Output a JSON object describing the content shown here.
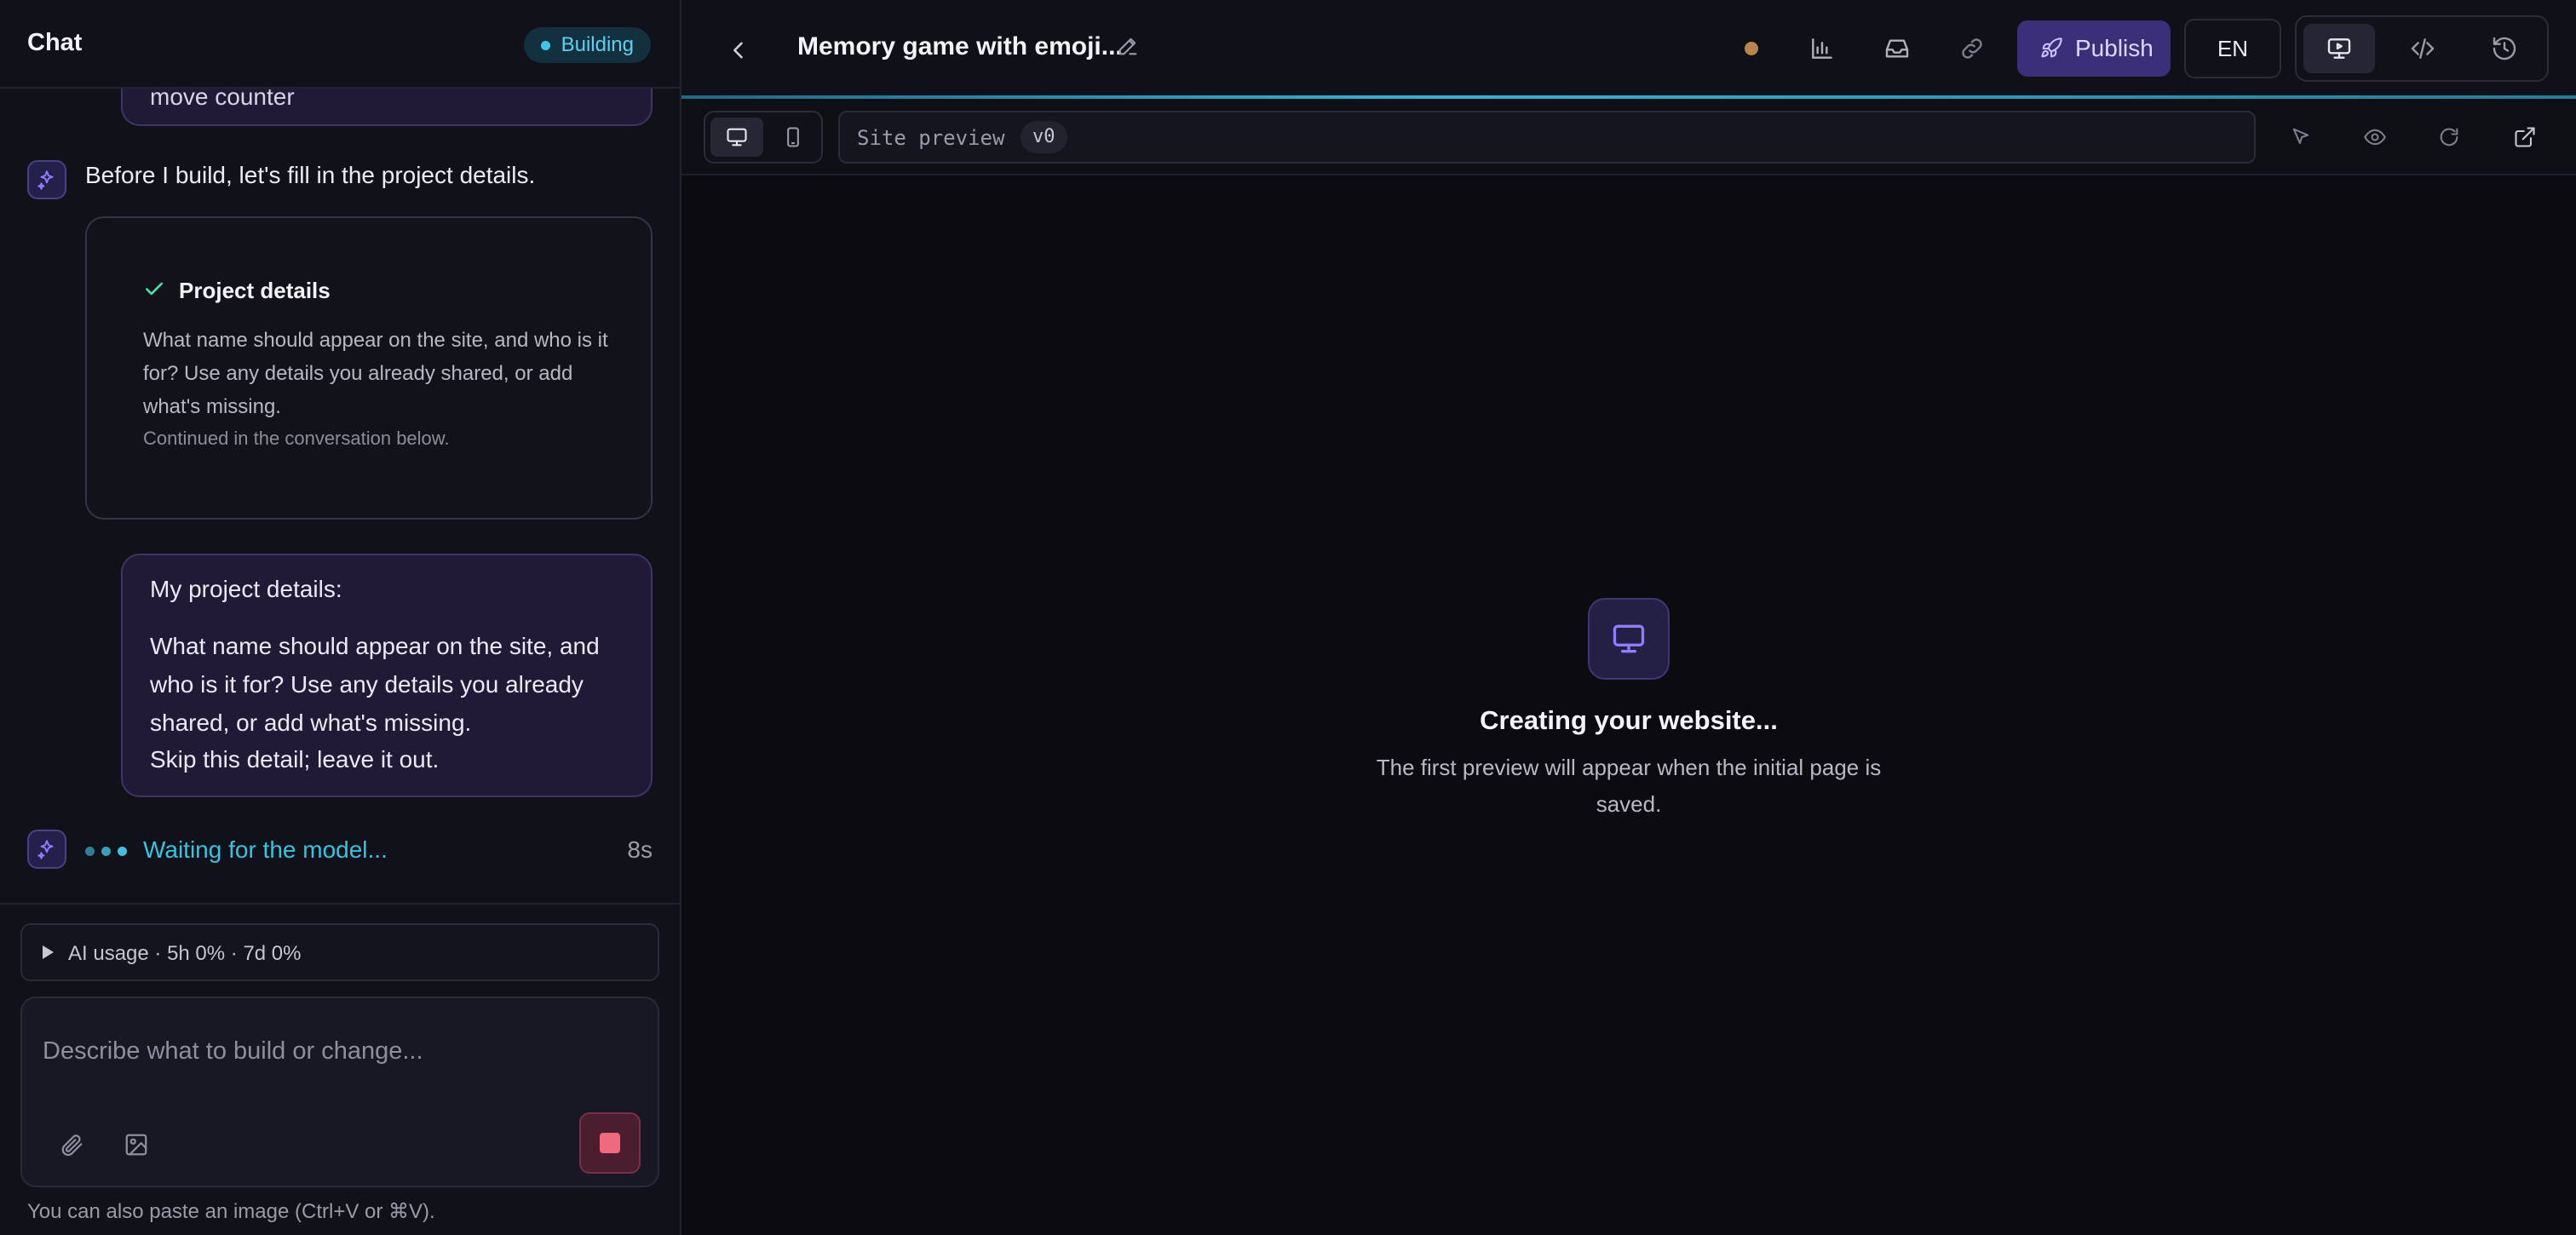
{
  "sidebar": {
    "title": "Chat",
    "status_badge": "Building",
    "prev_message_tail": "move counter",
    "ai_intro": "Before I build, let's fill in the project details.",
    "card": {
      "title": "Project details",
      "body": "What name should appear on the site, and who is it for? Use any details you already shared, or add what's missing.",
      "note": "Continued in the conversation below."
    },
    "user_message": {
      "heading": "My project details:",
      "question": "What name should appear on the site, and who is it for? Use any details you already shared, or add what's missing.",
      "answer": "Skip this detail; leave it out."
    },
    "waiting": {
      "text": "Waiting for the model...",
      "elapsed": "8s"
    },
    "usage": "AI usage · 5h 0% · 7d 0%",
    "composer": {
      "placeholder": "Describe what to build or change...",
      "hint": "You can also paste an image (Ctrl+V or ⌘V)."
    }
  },
  "topbar": {
    "project_title": "Memory game with emoji...",
    "publish_label": "Publish",
    "language": "EN",
    "status_color": "#b8864a"
  },
  "preview_bar": {
    "label": "Site preview",
    "version": "v0"
  },
  "canvas": {
    "title": "Creating your website...",
    "subtitle": "The first preview will appear when the initial page is saved."
  },
  "colors": {
    "accent": "#3a2f78",
    "status_building": "#3cc8ea",
    "stop": "#f0697e",
    "check": "#4ee0a6"
  }
}
